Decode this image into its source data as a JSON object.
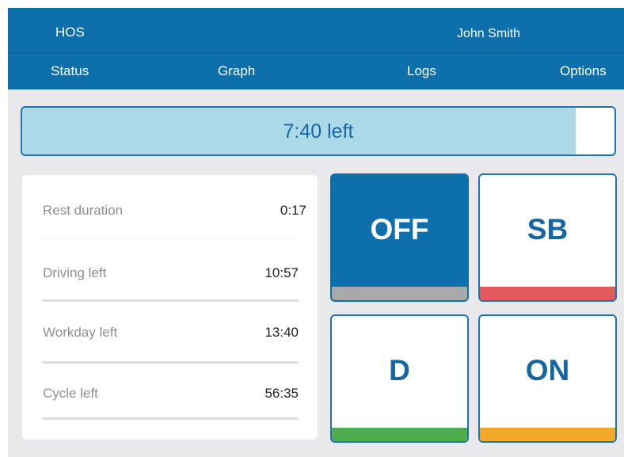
{
  "header": {
    "app_title": "HOS",
    "user_name": "John Smith",
    "tabs": [
      {
        "label": "Status"
      },
      {
        "label": "Graph"
      },
      {
        "label": "Logs"
      },
      {
        "label": "Options"
      }
    ]
  },
  "time_left": {
    "label": "7:40 left",
    "fill_fraction": 0.934
  },
  "stats": [
    {
      "label": "Rest duration",
      "value": "0:17"
    },
    {
      "label": "Driving left",
      "value": "10:57"
    },
    {
      "label": "Workday left",
      "value": "13:40"
    },
    {
      "label": "Cycle left",
      "value": "56:35"
    }
  ],
  "status_buttons": [
    {
      "label": "OFF",
      "color": "#a9a9a9",
      "active": true
    },
    {
      "label": "SB",
      "color": "#e15a59",
      "active": false
    },
    {
      "label": "D",
      "color": "#4eae4d",
      "active": false
    },
    {
      "label": "ON",
      "color": "#f0a928",
      "active": false
    }
  ],
  "colors": {
    "header": "#0d6fab",
    "accent_text": "#1566a3",
    "progress_fill": "#acd9e8"
  }
}
